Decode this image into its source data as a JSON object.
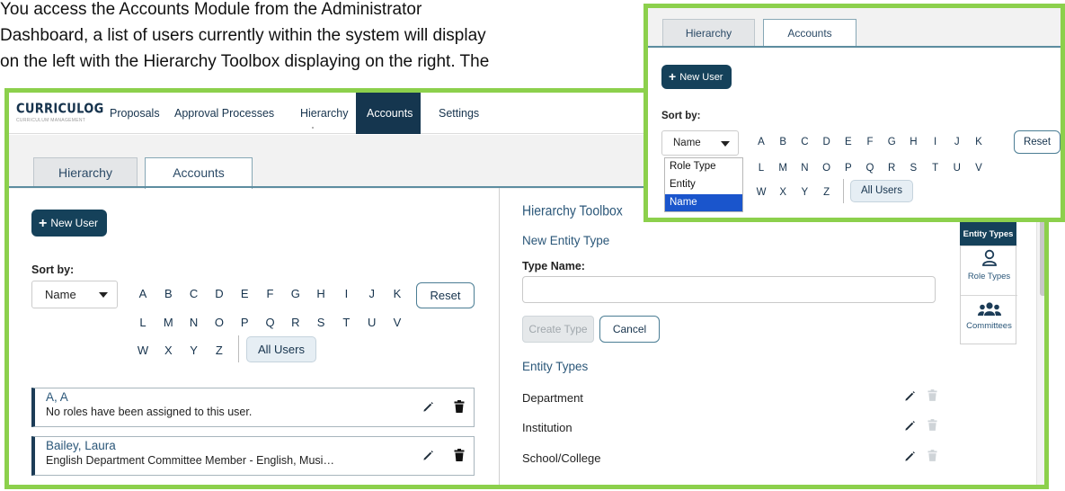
{
  "doc": {
    "lines": [
      "You access the Accounts Module from the Administrator",
      "Dashboard, a list of users currently within the system will display",
      "on the left with the Hierarchy Toolbox displaying on the right. The"
    ]
  },
  "app": {
    "logo_text": "CURRICULOG",
    "logo_subtext": "CURRICULUM MANAGEMENT",
    "nav": [
      "Proposals",
      "Approval Processes",
      "Hierarchy",
      "Accounts",
      "Settings"
    ],
    "active_nav": "Accounts",
    "tabs": [
      "Hierarchy",
      "Accounts"
    ],
    "active_tab": "Accounts"
  },
  "accounts": {
    "new_user_label": "New User",
    "sort_label": "Sort by:",
    "sort_value": "Name",
    "sort_options": [
      "Role Type",
      "Entity",
      "Name"
    ],
    "letters_row1": [
      "A",
      "B",
      "C",
      "D",
      "E",
      "F",
      "G",
      "H",
      "I",
      "J",
      "K"
    ],
    "letters_row2": [
      "L",
      "M",
      "N",
      "O",
      "P",
      "Q",
      "R",
      "S",
      "T",
      "U",
      "V"
    ],
    "letters_row3": [
      "W",
      "X",
      "Y",
      "Z"
    ],
    "reset_label": "Reset",
    "all_users_label": "All Users",
    "users": [
      {
        "name": "A, A",
        "desc": "No roles have been assigned to this user."
      },
      {
        "name": "Bailey, Laura",
        "desc": "English Department Committee Member - English, Musi…"
      }
    ]
  },
  "toolbox": {
    "title": "Hierarchy Toolbox",
    "new_entity_type": "New Entity Type",
    "type_name_label": "Type Name:",
    "create_label": "Create Type",
    "cancel_label": "Cancel",
    "entity_types_heading": "Entity Types",
    "entity_types": [
      "Department",
      "Institution",
      "School/College"
    ],
    "side_panel": {
      "entity_types": "Entity Types",
      "role_types": "Role Types",
      "committees": "Committees"
    }
  },
  "colors": {
    "frame_green": "#8cd04c",
    "navy": "#15364f",
    "teal_button": "#15415a",
    "selected_option": "#1a55cc"
  }
}
